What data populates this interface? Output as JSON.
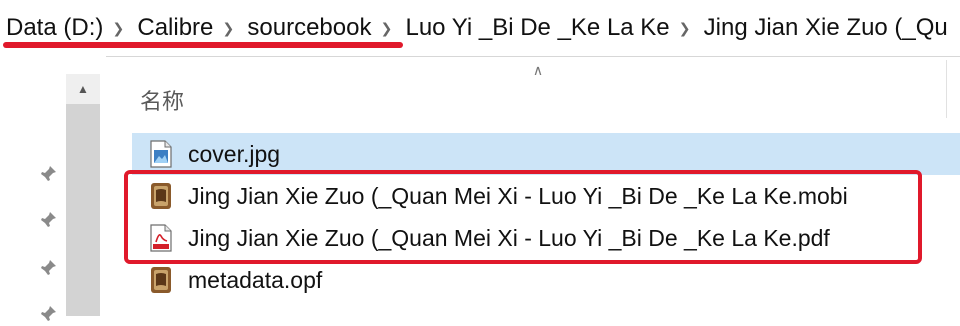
{
  "breadcrumb": {
    "items": [
      "Data (D:)",
      "Calibre",
      "sourcebook",
      "Luo Yi _Bi De _Ke La Ke",
      "Jing Jian Xie Zuo (_Qu"
    ],
    "separator_icon": "chevron-right-icon"
  },
  "list": {
    "column_name": "名称",
    "files": [
      {
        "name": "cover.jpg",
        "icon": "image-file-icon",
        "selected": true
      },
      {
        "name": "Jing Jian Xie Zuo (_Quan Mei Xi - Luo Yi _Bi De _Ke La Ke.mobi",
        "icon": "calibre-book-icon",
        "selected": false
      },
      {
        "name": "Jing Jian Xie Zuo (_Quan Mei Xi - Luo Yi _Bi De _Ke La Ke.pdf",
        "icon": "pdf-file-icon",
        "selected": false
      },
      {
        "name": "metadata.opf",
        "icon": "calibre-book-icon",
        "selected": false
      }
    ]
  },
  "colors": {
    "annotation_red": "#e0192b",
    "selection_blue": "#cce4f7"
  }
}
